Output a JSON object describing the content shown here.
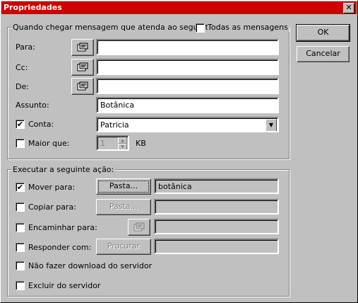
{
  "window": {
    "title": "Propriedades",
    "close_glyph": "✕"
  },
  "conditions": {
    "legend": "Quando chegar mensagem que atenda ao seguinte:",
    "all_messages": {
      "label": "Todas as mensagens",
      "checked": false
    },
    "para": {
      "label": "Para:",
      "value": ""
    },
    "cc": {
      "label": "Cc:",
      "value": ""
    },
    "de": {
      "label": "De:",
      "value": ""
    },
    "assunto": {
      "label": "Assunto:",
      "value": "Botânica"
    },
    "conta": {
      "label": "Conta:",
      "checked": true,
      "value": "Patricia"
    },
    "maior_que": {
      "label": "Maior que:",
      "checked": false,
      "value": "1",
      "unit": "KB"
    }
  },
  "actions": {
    "legend": "Executar a seguinte ação:",
    "mover": {
      "label": "Mover para:",
      "checked": true,
      "button": "Pasta...",
      "value": "botânica"
    },
    "copiar": {
      "label": "Copiar para:",
      "checked": false,
      "button": "Pasta...",
      "value": ""
    },
    "encaminhar": {
      "label": "Encaminhar para:",
      "checked": false,
      "value": ""
    },
    "responder": {
      "label": "Responder com:",
      "checked": false,
      "button": "Procurar",
      "value": ""
    },
    "nao_download": {
      "label": "Não fazer download do servidor",
      "checked": false
    },
    "excluir": {
      "label": "Excluir do servidor",
      "checked": false
    }
  },
  "buttons": {
    "ok": "OK",
    "cancel": "Cancelar"
  },
  "glyphs": {
    "check": "✔",
    "dropdown": "▼",
    "spin_up": "▲",
    "spin_down": "▼"
  },
  "icons": {
    "address_book": "address-book-icon"
  }
}
